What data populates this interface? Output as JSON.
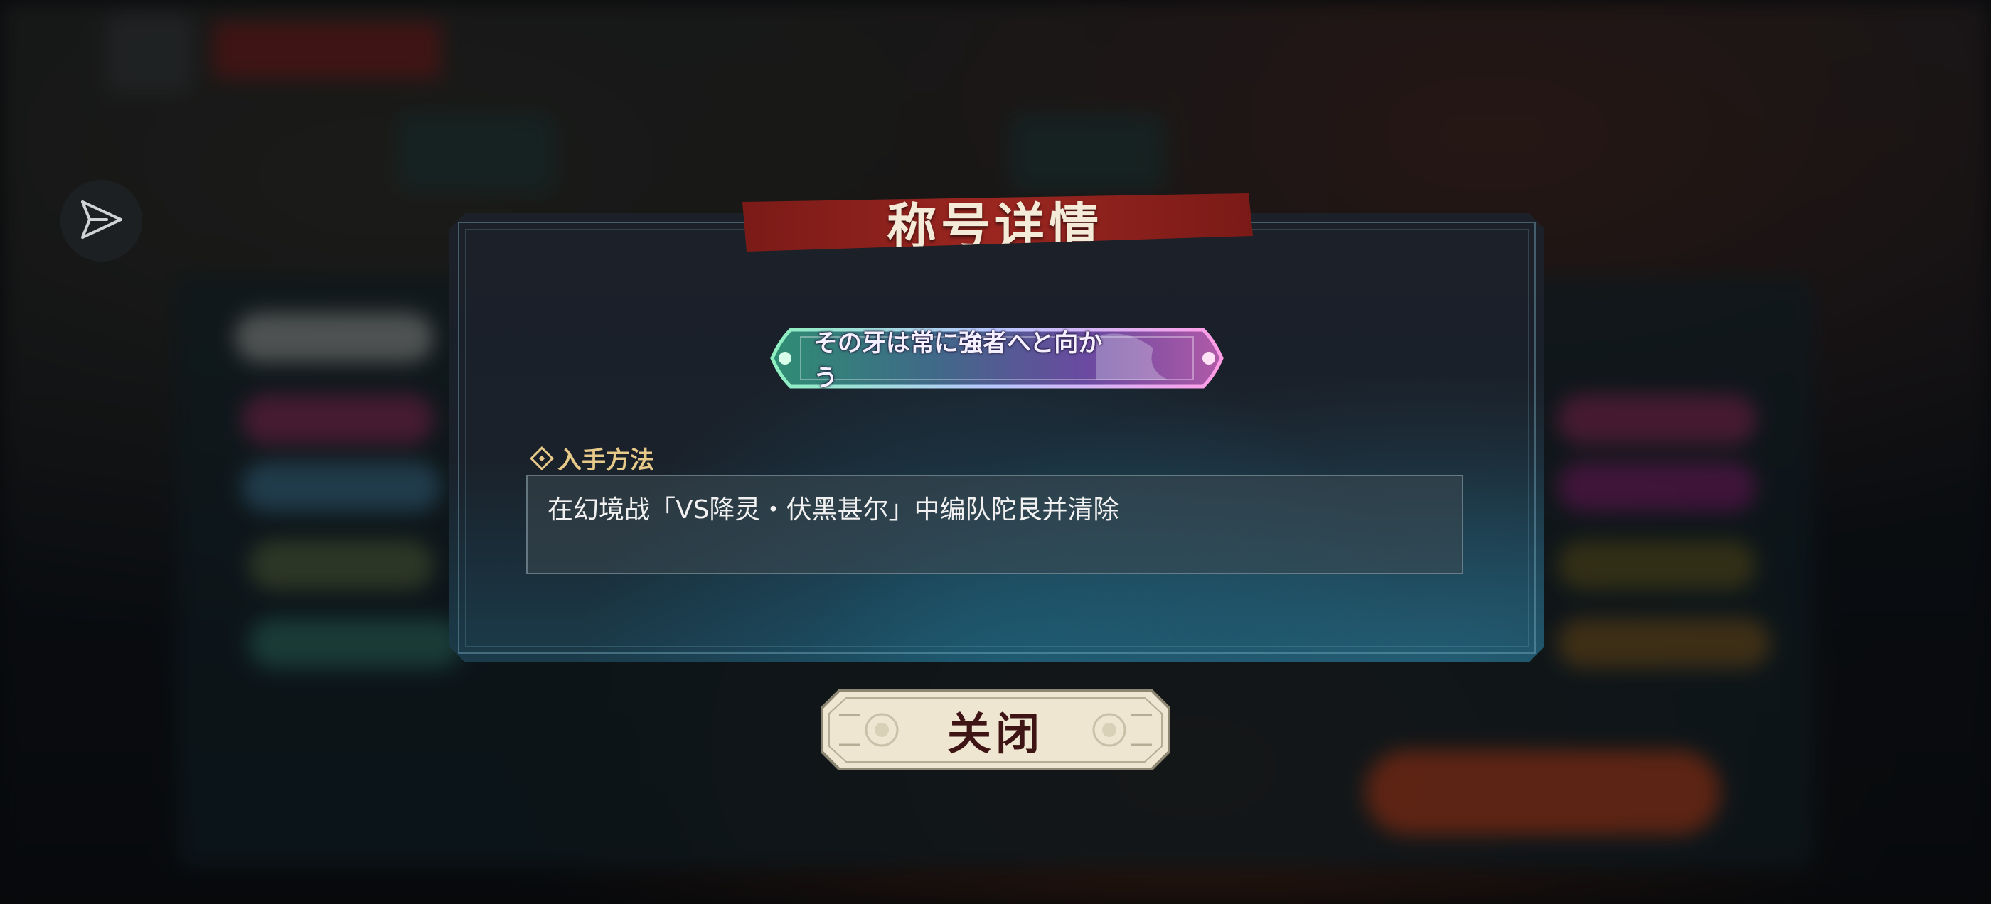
{
  "dialog": {
    "title": "称号详情",
    "title_plate_text": "その牙は常に強者へと向かう",
    "section_label": "入手方法",
    "method_text": "在幻境战「VS降灵・伏黑甚尔」中编队陀艮并清除",
    "close_label": "关闭"
  },
  "colors": {
    "ribbon": "#9b2620",
    "accent_gold": "#e7c98a",
    "dialog_bg": "#1a212a",
    "button_bg": "#efe6d2",
    "button_text": "#3e1414"
  },
  "icons": {
    "share": "share-icon",
    "section": "diamond-icon"
  }
}
